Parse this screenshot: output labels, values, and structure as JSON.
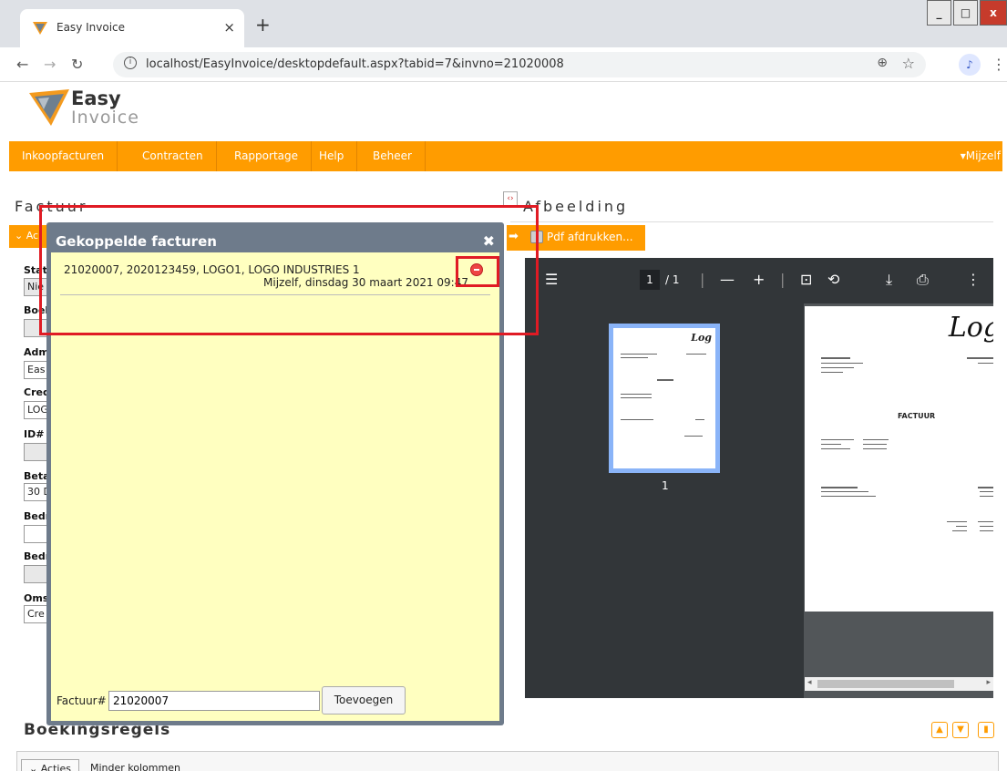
{
  "browser": {
    "tab_title": "Easy Invoice",
    "tab_close": "×",
    "new_tab": "+",
    "url": "localhost/EasyInvoice/desktopdefault.aspx?tabid=7&invno=21020008",
    "profile_initial": "♪",
    "win_min": "_",
    "win_max": "□",
    "win_close": "x"
  },
  "logo": {
    "line1": "Easy",
    "line2": "Invoice"
  },
  "menu": {
    "items": [
      "Inkoopfacturen",
      "Contracten",
      "Rapportage",
      "Help",
      "Beheer"
    ],
    "user": "▾Mijzelf"
  },
  "sections": {
    "factuur": "Factuur",
    "afbeelding": "Afbeelding",
    "boekingsregels": "Boekingsregels"
  },
  "left_form": {
    "actions": "⌄ Ac",
    "fields": [
      {
        "label": "Stat",
        "value": "Nie"
      },
      {
        "label": "Boek",
        "value": ""
      },
      {
        "label": "Adm",
        "value": "Eas"
      },
      {
        "label": "Cred",
        "value": "LOG"
      },
      {
        "label": "ID#",
        "value": ""
      },
      {
        "label": "Beta",
        "value": "30 D"
      },
      {
        "label": "Bedr",
        "value": ""
      },
      {
        "label": "Bedr",
        "value": ""
      },
      {
        "label": "Oms",
        "value": "Cre"
      }
    ]
  },
  "pdf": {
    "print_label": "Pdf afdrukken...",
    "page_current": "1",
    "page_total": "/ 1",
    "thumb_label": "1",
    "logo_text": "Log",
    "doc_title": "FACTUUR"
  },
  "modal": {
    "title": "Gekoppelde facturen",
    "close": "✖",
    "item": {
      "line1": "21020007, 2020123459, LOGO1, LOGO INDUSTRIES 1",
      "user": "Mijzelf",
      "date": ", dinsdag 30 maart 2021 09:47"
    },
    "input_label": "Factuur#",
    "input_value": "21020007",
    "add_button": "Toevoegen"
  },
  "bottom": {
    "actions": "⌄ Acties",
    "fewer_columns": "Minder kolommen"
  },
  "colors": {
    "accent": "#ff9c00",
    "modal_frame": "#6e7b8b",
    "modal_body": "#ffffc0",
    "highlight": "#e01b24"
  }
}
